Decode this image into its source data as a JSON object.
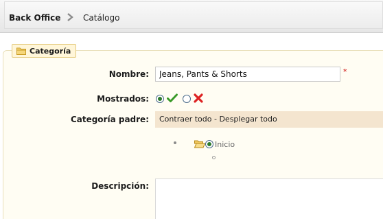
{
  "breadcrumb": {
    "root": "Back Office",
    "separator_icon": "chevron-right-icon",
    "current": "Catálogo"
  },
  "fieldset": {
    "legend_icon": "folder-icon",
    "legend": "Categoría"
  },
  "form": {
    "name_label": "Nombre:",
    "name_value": "Jeans, Pants & Shorts",
    "required_marker": "*",
    "shown_label": "Mostrados:",
    "shown_options": [
      {
        "icon": "check-icon",
        "selected": true,
        "color": "#3a9a2a"
      },
      {
        "icon": "cross-icon",
        "selected": false,
        "color": "#dd2222"
      }
    ],
    "parent_label": "Categoría padre:",
    "parent_toolbar": "Contraer todo - Desplegar todo",
    "tree": [
      {
        "label": "Inicio",
        "icon": "folder-open-icon",
        "selected": true
      }
    ],
    "description_label": "Descripción:",
    "description_value": ""
  },
  "colors": {
    "fieldset_bg": "#fffdf3",
    "legend_bg": "#fff6d9",
    "toolbar_bg": "#f4e5cf",
    "required": "#cc0000"
  }
}
